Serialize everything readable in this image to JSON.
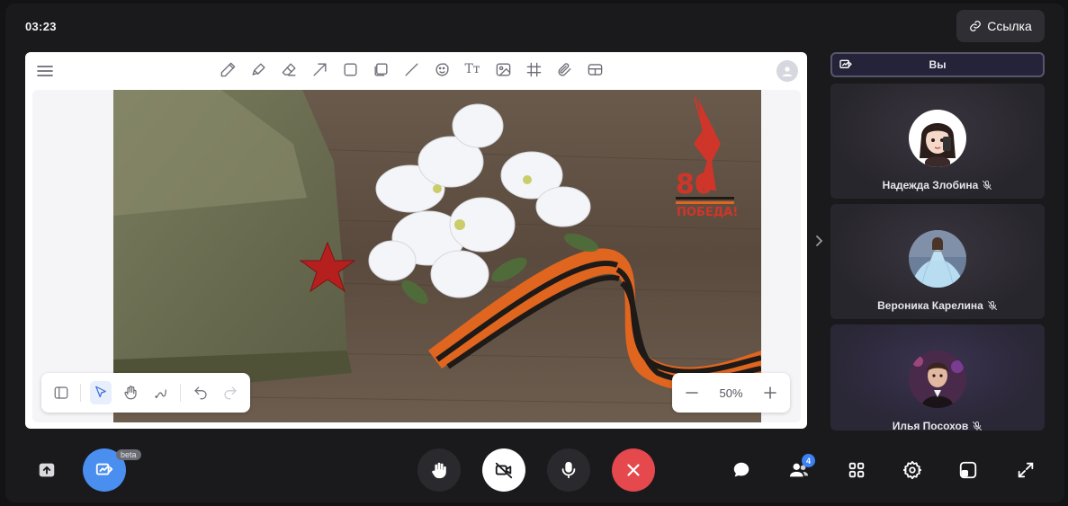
{
  "header": {
    "timer": "03:23",
    "link_button": "Ссылка"
  },
  "whiteboard": {
    "tools": [
      "pencil-icon",
      "marker-icon",
      "eraser-icon",
      "arrow-icon",
      "rectangle-icon",
      "sticky-note-icon",
      "line-icon",
      "sticker-icon",
      "text-icon",
      "image-icon",
      "grid-icon",
      "attachment-icon",
      "table-icon"
    ],
    "text_tool_label": "Tт",
    "zoom": "50%",
    "image_badge": {
      "number": "80",
      "word": "ПОБЕДА!"
    }
  },
  "participants": {
    "me_label": "Вы",
    "list": [
      {
        "name": "Надежда Злобина",
        "muted": true
      },
      {
        "name": "Вероника Карелина",
        "muted": true
      },
      {
        "name": "Илья Посохов",
        "muted": true
      }
    ]
  },
  "bottom_bar": {
    "beta_label": "beta",
    "participants_count": "4"
  },
  "colors": {
    "accent_blue": "#3b82f6",
    "end_call_red": "#e5484d",
    "background": "#131315"
  }
}
